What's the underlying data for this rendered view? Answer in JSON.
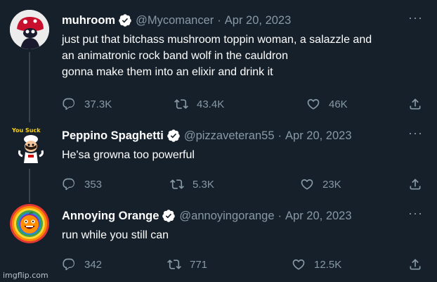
{
  "tweets": [
    {
      "name": "muhroom",
      "handle": "@Mycomancer",
      "date": "Apr 20, 2023",
      "text_lines": [
        "just put that bitchass mushroom toppin woman, a salazzle and",
        "an animatronic rock band wolf in the cauldron",
        "gonna make them into an elixir and drink it"
      ],
      "replies": "37.3K",
      "retweets": "43.4K",
      "likes": "46K",
      "avatar": "mushroom-character-avatar"
    },
    {
      "name": "Peppino Spaghetti",
      "handle": "@pizzaveteran55",
      "date": "Apr 20, 2023",
      "text_lines": [
        "He'sa growna too powerful"
      ],
      "replies": "353",
      "retweets": "5.3K",
      "likes": "23K",
      "avatar": "peppino-chef-avatar",
      "avatar_caption": "You Suck"
    },
    {
      "name": "Annoying Orange",
      "handle": "@annoyingorange",
      "date": "Apr 20, 2023",
      "text_lines": [
        "run while you still can"
      ],
      "replies": "342",
      "retweets": "771",
      "likes": "12.5K",
      "avatar": "annoying-orange-rainbow-avatar"
    }
  ],
  "ui": {
    "dot": "·",
    "more": "···"
  },
  "watermark": "imgflip.com",
  "colors": {
    "background": "#15202b",
    "text_primary": "#ffffff",
    "text_secondary": "#8899a6",
    "thread_line": "#38444d"
  }
}
